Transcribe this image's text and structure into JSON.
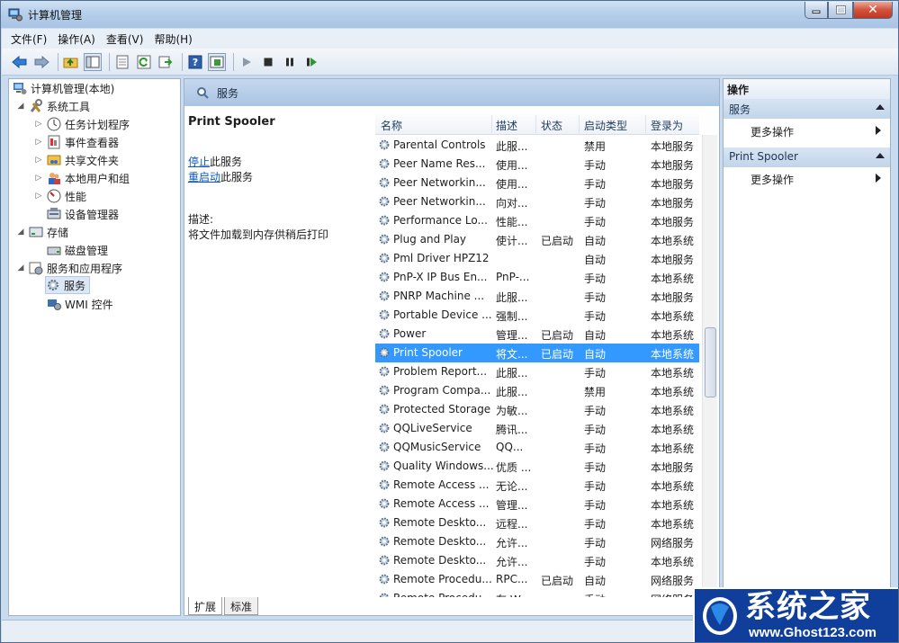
{
  "window": {
    "title": "计算机管理",
    "buttons": {
      "minimize": "—",
      "maximize": "□",
      "close": "✕"
    }
  },
  "menu": [
    "文件(F)",
    "操作(A)",
    "查看(V)",
    "帮助(H)"
  ],
  "toolbar": [
    "back-icon",
    "forward-icon",
    "up-folder-icon",
    "show-tree-icon",
    "properties-icon",
    "refresh-icon",
    "export-icon",
    "help-icon",
    "show-action-pane-icon",
    "start-service-icon",
    "stop-service-icon",
    "pause-service-icon",
    "restart-service-icon"
  ],
  "tree": {
    "root": "计算机管理(本地)",
    "system_tools": "系统工具",
    "task_scheduler": "任务计划程序",
    "event_viewer": "事件查看器",
    "shared_folders": "共享文件夹",
    "local_users": "本地用户和组",
    "performance": "性能",
    "device_manager": "设备管理器",
    "storage": "存储",
    "disk_management": "磁盘管理",
    "services_apps": "服务和应用程序",
    "services": "服务",
    "wmi": "WMI 控件"
  },
  "center": {
    "header": "服务",
    "selected_name": "Print Spooler",
    "stop_link": "停止",
    "stop_rest": "此服务",
    "restart_link": "重启动",
    "restart_rest": "此服务",
    "desc_label": "描述:",
    "desc_text": "将文件加载到内存供稍后打印",
    "columns": {
      "name": "名称",
      "desc": "描述",
      "status": "状态",
      "startup": "启动类型",
      "logon": "登录为"
    },
    "tabs": {
      "extended": "扩展",
      "standard": "标准"
    }
  },
  "services": [
    {
      "name": "Parental Controls",
      "desc": "此服...",
      "status": "",
      "startup": "禁用",
      "logon": "本地服务"
    },
    {
      "name": "Peer Name Res...",
      "desc": "使用...",
      "status": "",
      "startup": "手动",
      "logon": "本地服务"
    },
    {
      "name": "Peer Networkin...",
      "desc": "使用...",
      "status": "",
      "startup": "手动",
      "logon": "本地服务"
    },
    {
      "name": "Peer Networkin...",
      "desc": "向对...",
      "status": "",
      "startup": "手动",
      "logon": "本地服务"
    },
    {
      "name": "Performance Lo...",
      "desc": "性能...",
      "status": "",
      "startup": "手动",
      "logon": "本地服务"
    },
    {
      "name": "Plug and Play",
      "desc": "使计...",
      "status": "已启动",
      "startup": "自动",
      "logon": "本地系统"
    },
    {
      "name": "Pml Driver HPZ12",
      "desc": "",
      "status": "",
      "startup": "自动",
      "logon": "本地服务"
    },
    {
      "name": "PnP-X IP Bus En...",
      "desc": "PnP-...",
      "status": "",
      "startup": "手动",
      "logon": "本地系统"
    },
    {
      "name": "PNRP Machine ...",
      "desc": "此服...",
      "status": "",
      "startup": "手动",
      "logon": "本地服务"
    },
    {
      "name": "Portable Device ...",
      "desc": "强制...",
      "status": "",
      "startup": "手动",
      "logon": "本地系统"
    },
    {
      "name": "Power",
      "desc": "管理...",
      "status": "已启动",
      "startup": "自动",
      "logon": "本地系统"
    },
    {
      "name": "Print Spooler",
      "desc": "将文...",
      "status": "已启动",
      "startup": "自动",
      "logon": "本地系统"
    },
    {
      "name": "Problem Report...",
      "desc": "此服...",
      "status": "",
      "startup": "手动",
      "logon": "本地系统"
    },
    {
      "name": "Program Compa...",
      "desc": "此服...",
      "status": "",
      "startup": "禁用",
      "logon": "本地系统"
    },
    {
      "name": "Protected Storage",
      "desc": "为敏...",
      "status": "",
      "startup": "手动",
      "logon": "本地系统"
    },
    {
      "name": "QQLiveService",
      "desc": "腾讯...",
      "status": "",
      "startup": "手动",
      "logon": "本地系统"
    },
    {
      "name": "QQMusicService",
      "desc": "QQ...",
      "status": "",
      "startup": "手动",
      "logon": "本地系统"
    },
    {
      "name": "Quality Windows...",
      "desc": "优质 ...",
      "status": "",
      "startup": "手动",
      "logon": "本地服务"
    },
    {
      "name": "Remote Access ...",
      "desc": "无论...",
      "status": "",
      "startup": "手动",
      "logon": "本地系统"
    },
    {
      "name": "Remote Access ...",
      "desc": "管理...",
      "status": "",
      "startup": "手动",
      "logon": "本地系统"
    },
    {
      "name": "Remote Deskto...",
      "desc": "远程...",
      "status": "",
      "startup": "手动",
      "logon": "本地系统"
    },
    {
      "name": "Remote Deskto...",
      "desc": "允许...",
      "status": "",
      "startup": "手动",
      "logon": "网络服务"
    },
    {
      "name": "Remote Deskto...",
      "desc": "允许...",
      "status": "",
      "startup": "手动",
      "logon": "本地系统"
    },
    {
      "name": "Remote Procedu...",
      "desc": "RPC...",
      "status": "已启动",
      "startup": "自动",
      "logon": "网络服务"
    },
    {
      "name": "Remote Procedu...",
      "desc": "在 W...",
      "status": "",
      "startup": "手动",
      "logon": "网络服务"
    }
  ],
  "actions": {
    "title": "操作",
    "section1": "服务",
    "more1": "更多操作",
    "section2": "Print Spooler",
    "more2": "更多操作"
  },
  "watermark": {
    "cn": "系统之家",
    "url": "www.Ghost123.com"
  },
  "colors": {
    "selection": "#3399ff",
    "link": "#0b58c9",
    "header": "#aac4e3"
  }
}
